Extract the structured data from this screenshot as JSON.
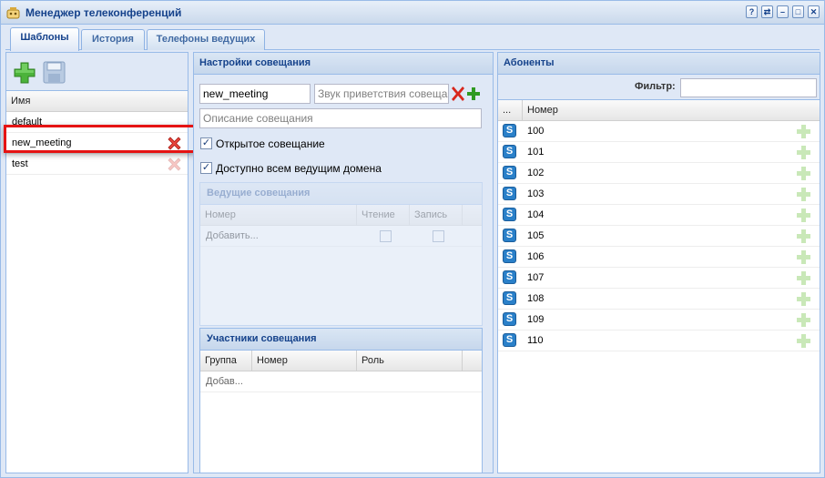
{
  "window": {
    "title": "Менеджер телеконференций"
  },
  "titlebar_buttons": [
    "?",
    "⇄",
    "–",
    "□",
    "✕"
  ],
  "tabs": [
    {
      "label": "Шаблоны",
      "active": true
    },
    {
      "label": "История",
      "active": false
    },
    {
      "label": "Телефоны ведущих",
      "active": false
    }
  ],
  "templates": {
    "column_header": "Имя",
    "items": [
      {
        "name": "default",
        "selected": false
      },
      {
        "name": "new_meeting",
        "selected": true
      },
      {
        "name": "test",
        "selected": false
      }
    ]
  },
  "settings": {
    "header": "Настройки совещания",
    "name_value": "new_meeting",
    "sound_placeholder": "Звук приветствия совещания",
    "description_placeholder": "Описание совещания",
    "open_meeting_label": "Открытое совещание",
    "open_meeting_checked": true,
    "domain_hosts_label": "Доступно всем ведущим домена",
    "domain_hosts_checked": true,
    "hosts": {
      "header": "Ведущие совещания",
      "columns": [
        "Номер",
        "Чтение",
        "Запись"
      ],
      "add_row": "Добавить..."
    },
    "participants": {
      "header": "Участники совещания",
      "columns": [
        "Группа",
        "Номер",
        "Роль"
      ],
      "add_row": "Добав..."
    }
  },
  "subscribers": {
    "header": "Абоненты",
    "filter_label": "Фильтр:",
    "filter_value": "",
    "columns": [
      "...",
      "Номер"
    ],
    "rows": [
      "100",
      "101",
      "102",
      "103",
      "104",
      "105",
      "106",
      "107",
      "108",
      "109",
      "110"
    ]
  },
  "colors": {
    "accent": "#15428b",
    "border": "#99bbe8",
    "highlight": "#e51313"
  }
}
